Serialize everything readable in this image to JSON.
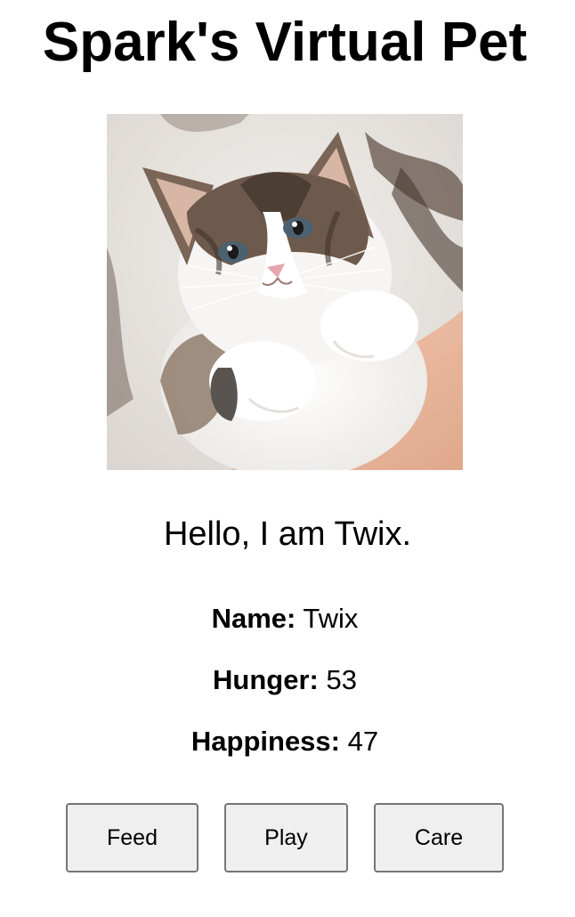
{
  "page": {
    "title": "Spark's Virtual Pet"
  },
  "pet": {
    "image_subject": "kitten-photo",
    "greeting": "Hello, I am Twix.",
    "stats": {
      "name_label": "Name:",
      "name_value": "Twix",
      "hunger_label": "Hunger:",
      "hunger_value": "53",
      "happiness_label": "Happiness:",
      "happiness_value": "47"
    }
  },
  "actions": {
    "feed_label": "Feed",
    "play_label": "Play",
    "care_label": "Care"
  },
  "colors": {
    "background": "#ffffff",
    "text": "#000000",
    "button_bg": "#efefef",
    "button_border": "#767676"
  }
}
